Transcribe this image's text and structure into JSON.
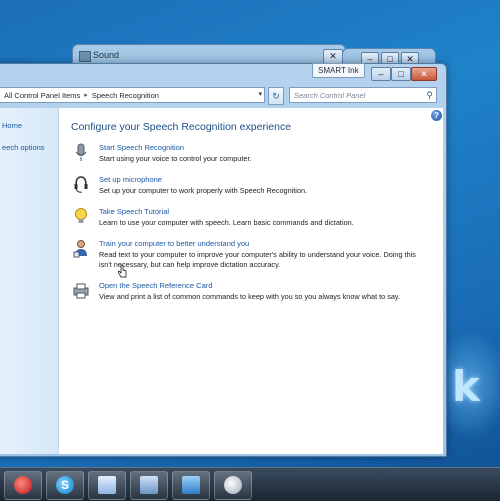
{
  "desktop": {
    "watermark_text": "k"
  },
  "back_window": {
    "title": "Sound"
  },
  "main_window": {
    "smart_ink_label": "SMART Ink",
    "address": {
      "crumb1": "All Control Panel Items",
      "crumb2": "Speech Recognition"
    },
    "search_placeholder": "Search Control Panel",
    "sidebar": {
      "items": [
        "Home",
        "eech options"
      ]
    },
    "heading": "Configure your Speech Recognition experience",
    "tasks": [
      {
        "icon": "microphone-icon",
        "link": "Start Speech Recognition",
        "desc": "Start using your voice to control your computer."
      },
      {
        "icon": "headset-icon",
        "link": "Set up microphone",
        "desc": "Set up your computer to work properly with Speech Recognition."
      },
      {
        "icon": "lightbulb-icon",
        "link": "Take Speech Tutorial",
        "desc": "Learn to use your computer with speech.  Learn basic commands and dictation."
      },
      {
        "icon": "train-person-icon",
        "link": "Train your computer to better understand you",
        "desc": "Read text to your computer to improve your computer's ability to understand your voice. Doing this isn't necessary, but can help improve dictation accuracy."
      },
      {
        "icon": "printer-icon",
        "link": "Open the Speech Reference Card",
        "desc": "View and print a list of common commands to keep with you so you always know what to say."
      }
    ]
  },
  "taskbar": {
    "items": [
      "media-player-icon",
      "skype-icon",
      "notepad-icon",
      "network-app-icon",
      "control-panel-icon",
      "shield-icon"
    ]
  }
}
